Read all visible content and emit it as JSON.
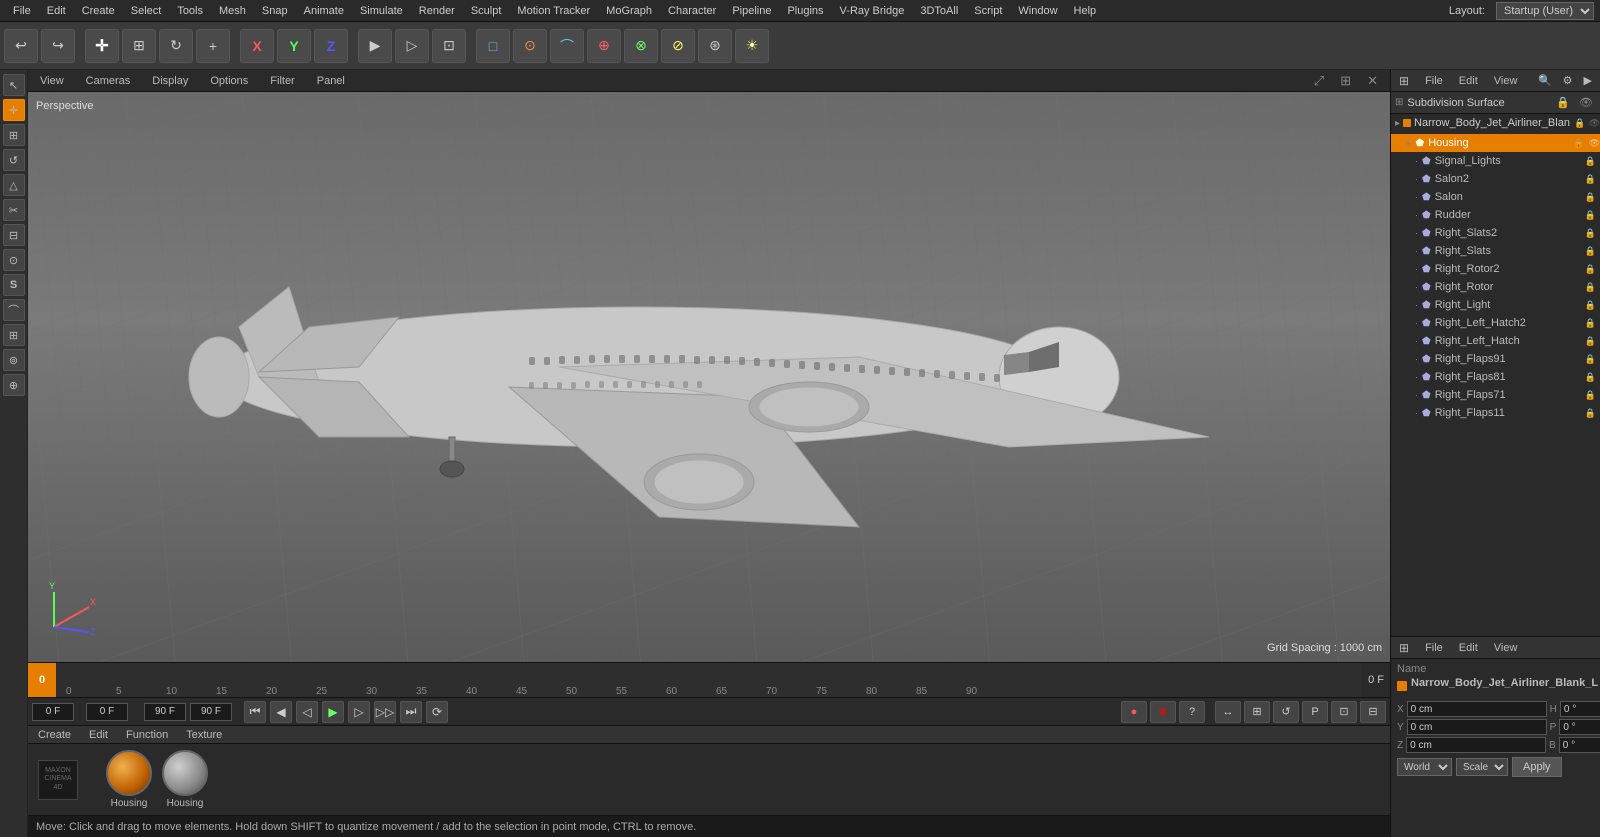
{
  "app": {
    "title": "Cinema 4D",
    "layout_label": "Layout:",
    "layout_value": "Startup (User)"
  },
  "menubar": {
    "items": [
      "File",
      "Edit",
      "Create",
      "Select",
      "Tools",
      "Mesh",
      "Snap",
      "Animate",
      "Simulate",
      "Render",
      "Sculpt",
      "Motion Tracker",
      "MoGraph",
      "Character",
      "Pipeline",
      "Plugins",
      "V-Ray Bridge",
      "3DToAll",
      "Script",
      "Window",
      "Help"
    ]
  },
  "toolbar": {
    "buttons": [
      {
        "name": "undo",
        "icon": "↩"
      },
      {
        "name": "redo",
        "icon": "↪"
      },
      {
        "name": "move",
        "icon": "✛"
      },
      {
        "name": "scale",
        "icon": "⊞"
      },
      {
        "name": "rotate",
        "icon": "↻"
      },
      {
        "name": "transform",
        "icon": "+"
      },
      {
        "name": "x-axis",
        "icon": "X"
      },
      {
        "name": "y-axis",
        "icon": "Y"
      },
      {
        "name": "z-axis",
        "icon": "Z"
      },
      {
        "name": "render-view",
        "icon": "▶"
      },
      {
        "name": "render",
        "icon": "▷"
      },
      {
        "name": "render-region",
        "icon": "⊡"
      },
      {
        "name": "cube",
        "icon": "□"
      },
      {
        "name": "curve",
        "icon": "⌒"
      },
      {
        "name": "spline",
        "icon": "⊙"
      },
      {
        "name": "deformer",
        "icon": "⊕"
      },
      {
        "name": "effector",
        "icon": "⊗"
      },
      {
        "name": "surface",
        "icon": "⊘"
      },
      {
        "name": "light",
        "icon": "☀"
      }
    ]
  },
  "left_panel": {
    "tools": [
      {
        "name": "select-tool",
        "icon": "↖",
        "active": false
      },
      {
        "name": "move-tool",
        "icon": "✛",
        "active": true
      },
      {
        "name": "scale-tool",
        "icon": "⊞",
        "active": false
      },
      {
        "name": "rotate-tool",
        "icon": "↺",
        "active": false
      },
      {
        "name": "polygon-tool",
        "icon": "△",
        "active": false
      },
      {
        "name": "knife-tool",
        "icon": "⟋",
        "active": false
      },
      {
        "name": "extrude-tool",
        "icon": "⧄",
        "active": false
      },
      {
        "name": "brush-tool",
        "icon": "⊙",
        "active": false
      },
      {
        "name": "material-tool",
        "icon": "S",
        "active": false
      },
      {
        "name": "bend-tool",
        "icon": "⌒",
        "active": false
      },
      {
        "name": "grid-tool",
        "icon": "⊞",
        "active": false
      },
      {
        "name": "camera-tool",
        "icon": "📷",
        "active": false
      },
      {
        "name": "light-tool",
        "icon": "☀",
        "active": false
      }
    ]
  },
  "viewport": {
    "label": "Perspective",
    "grid_spacing": "Grid Spacing : 1000 cm",
    "top_menu": [
      "View",
      "Cameras",
      "Display",
      "Options",
      "Filter",
      "Panel"
    ],
    "bg_color": "#6a6a6a"
  },
  "timeline": {
    "current_frame": "0",
    "start_frame": "0 F",
    "end_frame": "90 F",
    "ticks": [
      "0",
      "5",
      "10",
      "15",
      "20",
      "25",
      "30",
      "35",
      "40",
      "45",
      "50",
      "55",
      "60",
      "65",
      "70",
      "75",
      "80",
      "85",
      "90"
    ],
    "frame_label": "0 F"
  },
  "playback": {
    "frame_input": "0 F",
    "fps_input": "0 F",
    "end_input": "90 F",
    "end_input2": "90 F",
    "controls": [
      "⏮",
      "◀",
      "◁",
      "▶",
      "▷",
      "⏭",
      "⟳"
    ],
    "right_icons": [
      "🔴",
      "⊗",
      "?",
      "↔",
      "⊞",
      "↺",
      "P",
      "⊞",
      "⊟"
    ]
  },
  "hierarchy": {
    "menu": [
      "File",
      "Edit",
      "View"
    ],
    "title": "Subdivision Surface",
    "parent_name": "Narrow_Body_Jet_Airliner_Blan",
    "items": [
      {
        "name": "Housing",
        "level": 1,
        "has_children": true
      },
      {
        "name": "Signal_Lights",
        "level": 2
      },
      {
        "name": "Salon2",
        "level": 2
      },
      {
        "name": "Salon",
        "level": 2
      },
      {
        "name": "Rudder",
        "level": 2
      },
      {
        "name": "Right_Slats2",
        "level": 2
      },
      {
        "name": "Right_Slats",
        "level": 2
      },
      {
        "name": "Right_Rotor2",
        "level": 2
      },
      {
        "name": "Right_Rotor",
        "level": 2
      },
      {
        "name": "Right_Light",
        "level": 2
      },
      {
        "name": "Right_Left_Hatch2",
        "level": 2
      },
      {
        "name": "Right_Left_Hatch",
        "level": 2
      },
      {
        "name": "Right_Flaps91",
        "level": 2
      },
      {
        "name": "Right_Flaps81",
        "level": 2
      },
      {
        "name": "Right_Flaps71",
        "level": 2
      },
      {
        "name": "Right_Flaps11",
        "level": 2
      }
    ]
  },
  "properties": {
    "menu": [
      "File",
      "Edit",
      "View"
    ],
    "label": "Name",
    "name": "Narrow_Body_Jet_Airliner_Blank_L",
    "coords": {
      "x": {
        "label": "X",
        "val": "0 cm",
        "h_label": "H",
        "h_val": "0°"
      },
      "y": {
        "label": "Y",
        "val": "0 cm",
        "p_label": "P",
        "p_val": "0°"
      },
      "z": {
        "label": "Z",
        "val": "0 cm",
        "b_label": "B",
        "b_val": "0°"
      }
    },
    "world_label": "World",
    "scale_label": "Scale",
    "apply_label": "Apply"
  },
  "materials": {
    "menu_items": [
      "Create",
      "Edit",
      "Function",
      "Texture"
    ],
    "items": [
      {
        "name": "Housing",
        "type": "orange"
      },
      {
        "name": "Housing",
        "type": "gray"
      }
    ]
  },
  "status": {
    "text": "Move: Click and drag to move elements. Hold down SHIFT to quantize movement / add to the selection in point mode, CTRL to remove.",
    "logo": "MAXON CINEMA 4D"
  }
}
